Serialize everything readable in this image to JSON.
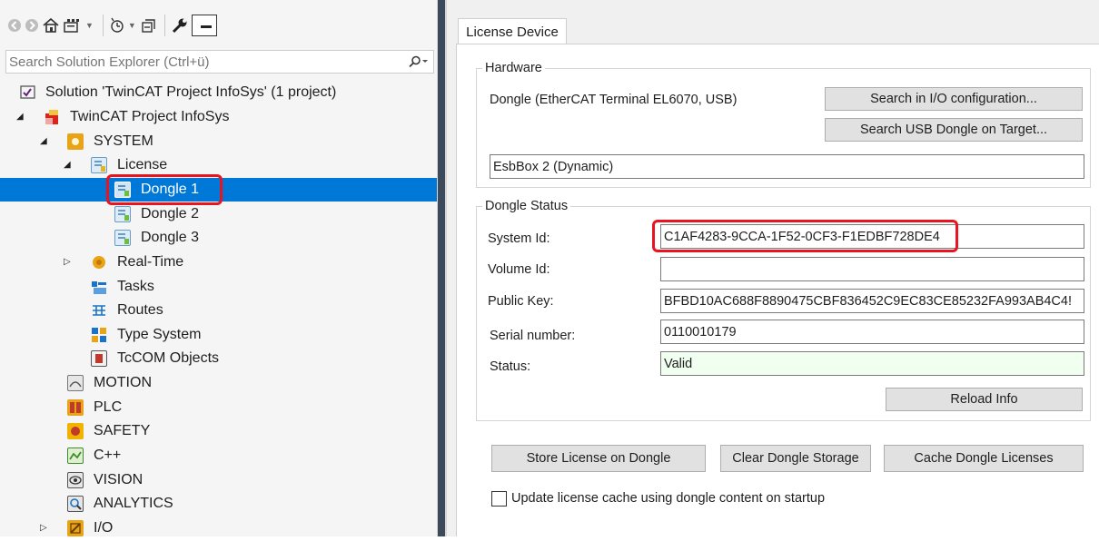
{
  "toolbar": {
    "icons": [
      "back-icon",
      "forward-icon",
      "home-icon",
      "sync-icon",
      "pending-changes-icon",
      "collapse-all-icon",
      "properties-icon",
      "preview-icon"
    ]
  },
  "search": {
    "placeholder": "Search Solution Explorer (Ctrl+ü)",
    "value": ""
  },
  "tree": {
    "solution": "Solution 'TwinCAT Project InfoSys' (1 project)",
    "project": "TwinCAT Project InfoSys",
    "system": "SYSTEM",
    "license": "License",
    "dongles": [
      "Dongle 1",
      "Dongle 2",
      "Dongle 3"
    ],
    "realtime": "Real-Time",
    "tasks": "Tasks",
    "routes": "Routes",
    "type_system": "Type System",
    "tccom": "TcCOM Objects",
    "motion": "MOTION",
    "plc": "PLC",
    "safety": "SAFETY",
    "cpp": "C++",
    "vision": "VISION",
    "analytics": "ANALYTICS",
    "io": "I/O"
  },
  "tab": {
    "label": "License Device"
  },
  "hardware": {
    "legend": "Hardware",
    "dongle_desc": "Dongle (EtherCAT Terminal EL6070, USB)",
    "search_io_button": "Search in I/O configuration...",
    "search_usb_button": "Search USB Dongle on Target...",
    "device_value": "EsbBox 2 (Dynamic)"
  },
  "status": {
    "legend": "Dongle Status",
    "system_id_label": "System Id:",
    "system_id": "C1AF4283-9CCA-1F52-0CF3-F1EDBF728DE4",
    "volume_id_label": "Volume Id:",
    "volume_id": "",
    "public_key_label": "Public Key:",
    "public_key": "BFBD10AC688F8890475CBF836452C9EC83CE85232FA993AB4C4!",
    "serial_label": "Serial number:",
    "serial": "0110010179",
    "status_label": "Status:",
    "status": "Valid",
    "reload_button": "Reload Info"
  },
  "actions": {
    "store_button": "Store License on Dongle",
    "clear_button": "Clear Dongle Storage",
    "cache_button": "Cache Dongle Licenses",
    "update_checkbox_label": "Update license cache using dongle content on startup",
    "update_checked": false
  },
  "colors": {
    "selection": "#0078d7",
    "highlight_box": "#e8141f",
    "valid_bg": "#f0fff0",
    "splitter": "#3d4a5c"
  }
}
